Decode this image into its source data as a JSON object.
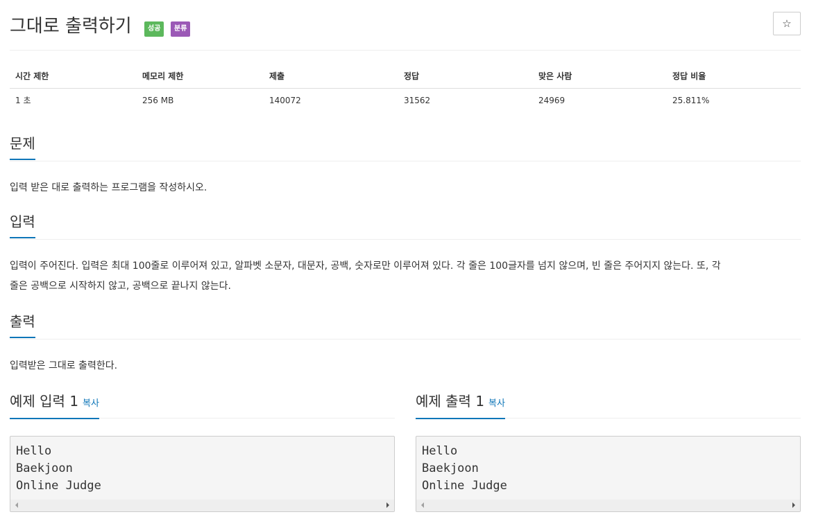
{
  "header": {
    "title": "그대로 출력하기",
    "badges": {
      "result": "성공",
      "category": "분류"
    },
    "star_icon": "☆",
    "colors": {
      "success": "#5cb85c",
      "category": "#9b59b6",
      "accent": "#0e76b8"
    }
  },
  "info_table": {
    "headers": [
      "시간 제한",
      "메모리 제한",
      "제출",
      "정답",
      "맞은 사람",
      "정답 비율"
    ],
    "values": [
      "1 초",
      "256 MB",
      "140072",
      "31562",
      "24969",
      "25.811%"
    ]
  },
  "problem": {
    "heading": "문제",
    "text": "입력 받은 대로 출력하는 프로그램을 작성하시오."
  },
  "input": {
    "heading": "입력",
    "line1": "입력이 주어진다. 입력은 최대 100줄로 이루어져 있고, 알파벳 소문자, 대문자, 공백, 숫자로만 이루어져 있다. 각 줄은 100글자를 넘지 않으며, 빈 줄은 주어지지 않는다. 또, 각",
    "line2": "줄은 공백으로 시작하지 않고, 공백으로 끝나지 않는다."
  },
  "output": {
    "heading": "출력",
    "text": "입력받은 그대로 출력한다."
  },
  "samples": {
    "input": {
      "heading": "예제 입력 1",
      "copy": "복사",
      "lines": "Hello\nBaekjoon\nOnline Judge"
    },
    "output": {
      "heading": "예제 출력 1",
      "copy": "복사",
      "lines": "Hello\nBaekjoon\nOnline Judge"
    }
  }
}
